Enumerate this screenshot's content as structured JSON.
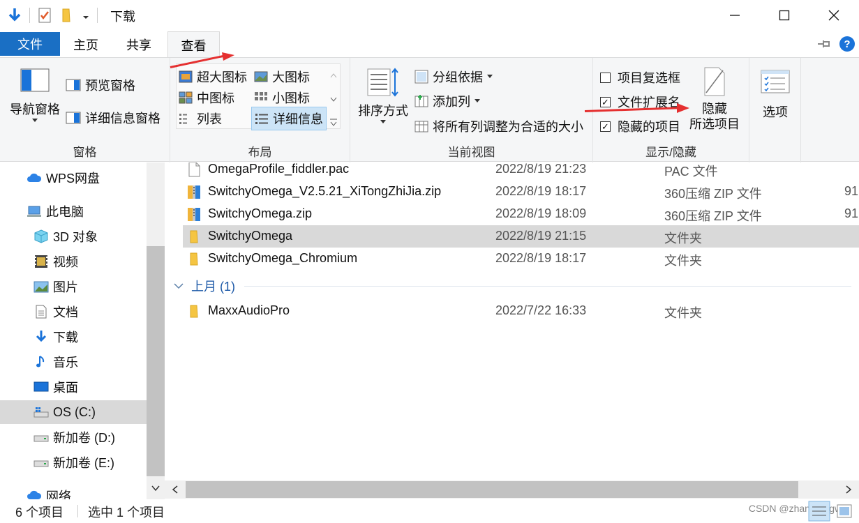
{
  "window": {
    "title": "下载",
    "controls": [
      "minimize-icon",
      "maximize-icon",
      "close-icon"
    ]
  },
  "tabs": [
    {
      "label": "文件"
    },
    {
      "label": "主页"
    },
    {
      "label": "共享"
    },
    {
      "label": "查看"
    }
  ],
  "ribbon": {
    "panes": {
      "nav_pane": "导航窗格",
      "preview_pane": "预览窗格",
      "details_pane": "详细信息窗格",
      "label": "窗格"
    },
    "layout": {
      "items": [
        "超大图标",
        "大图标",
        "中图标",
        "小图标",
        "列表",
        "详细信息"
      ],
      "selected": "详细信息",
      "label": "布局"
    },
    "current_view": {
      "sort": "排序方式",
      "group_by": "分组依据",
      "add_columns": "添加列",
      "fit_columns": "将所有列调整为合适的大小",
      "label": "当前视图"
    },
    "show_hide": {
      "item_checkboxes": {
        "label": "项目复选框",
        "checked": false
      },
      "file_extensions": {
        "label": "文件扩展名",
        "checked": true
      },
      "hidden_items": {
        "label": "隐藏的项目",
        "checked": true
      },
      "hide_selected_line1": "隐藏",
      "hide_selected_line2": "所选项目",
      "label": "显示/隐藏"
    },
    "options": "选项"
  },
  "sidebar": {
    "items": [
      {
        "label": "WPS网盘",
        "icon": "cloud-icon"
      },
      {
        "label": "此电脑",
        "icon": "computer-icon"
      },
      {
        "label": "3D 对象",
        "icon": "cube-icon"
      },
      {
        "label": "视频",
        "icon": "video-icon"
      },
      {
        "label": "图片",
        "icon": "picture-icon"
      },
      {
        "label": "文档",
        "icon": "document-icon"
      },
      {
        "label": "下载",
        "icon": "download-icon"
      },
      {
        "label": "音乐",
        "icon": "music-icon"
      },
      {
        "label": "桌面",
        "icon": "desktop-icon"
      },
      {
        "label": "OS (C:)",
        "icon": "drive-icon"
      },
      {
        "label": "新加卷 (D:)",
        "icon": "drive-icon"
      },
      {
        "label": "新加卷 (E:)",
        "icon": "drive-icon"
      },
      {
        "label": "网络",
        "icon": "network-icon"
      }
    ]
  },
  "files": [
    {
      "name": "OmegaProfile_fiddler.pac",
      "date": "2022/8/19 21:23",
      "type": "PAC 文件",
      "size": ""
    },
    {
      "name": "SwitchyOmega_V2.5.21_XiTongZhiJia.zip",
      "date": "2022/8/19 18:17",
      "type": "360压缩 ZIP 文件",
      "size": "91"
    },
    {
      "name": "SwitchyOmega.zip",
      "date": "2022/8/19 18:09",
      "type": "360压缩 ZIP 文件",
      "size": "91"
    },
    {
      "name": "SwitchyOmega",
      "date": "2022/8/19 21:15",
      "type": "文件夹",
      "size": ""
    },
    {
      "name": "SwitchyOmega_Chromium",
      "date": "2022/8/19 18:17",
      "type": "文件夹",
      "size": ""
    }
  ],
  "group_last_month": {
    "label": "上月 (1)"
  },
  "files_last_month": [
    {
      "name": "MaxxAudioPro",
      "date": "2022/7/22 16:33",
      "type": "文件夹",
      "size": ""
    }
  ],
  "status": {
    "count": "6 个项目",
    "selected": "选中 1 个项目"
  },
  "watermark": "CSDN @zhangfengwei"
}
